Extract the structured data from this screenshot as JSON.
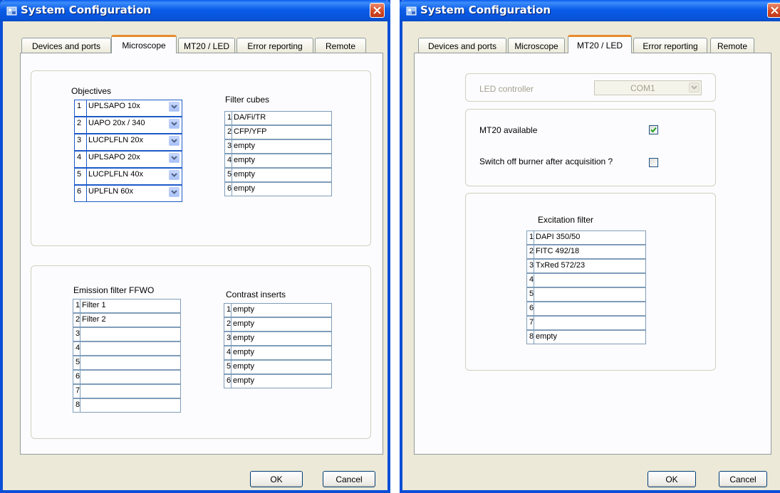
{
  "window_title": "System Configuration",
  "tabs": [
    "Devices and ports",
    "Microscope",
    "MT20 / LED",
    "Error reporting",
    "Remote"
  ],
  "buttons": {
    "ok": "OK",
    "cancel": "Cancel"
  },
  "microscope": {
    "objectives_label": "Objectives",
    "objectives": [
      {
        "num": "1",
        "value": "UPLSAPO 10x"
      },
      {
        "num": "2",
        "value": "UAPO 20x / 340"
      },
      {
        "num": "3",
        "value": "LUCPLFLN 20x"
      },
      {
        "num": "4",
        "value": "UPLSAPO 20x"
      },
      {
        "num": "5",
        "value": "LUCPLFLN 40x"
      },
      {
        "num": "6",
        "value": "UPLFLN 60x"
      }
    ],
    "filter_cubes_label": "Filter cubes",
    "filter_cubes": [
      {
        "num": "1",
        "value": "DA/Fi/TR"
      },
      {
        "num": "2",
        "value": "CFP/YFP"
      },
      {
        "num": "3",
        "value": "empty"
      },
      {
        "num": "4",
        "value": "empty"
      },
      {
        "num": "5",
        "value": "empty"
      },
      {
        "num": "6",
        "value": "empty"
      }
    ],
    "emission_label": "Emission filter FFWO",
    "emission_filters": [
      {
        "num": "1",
        "value": "Filter 1"
      },
      {
        "num": "2",
        "value": "Filter 2"
      },
      {
        "num": "3",
        "value": ""
      },
      {
        "num": "4",
        "value": ""
      },
      {
        "num": "5",
        "value": ""
      },
      {
        "num": "6",
        "value": ""
      },
      {
        "num": "7",
        "value": ""
      },
      {
        "num": "8",
        "value": ""
      }
    ],
    "contrast_label": "Contrast inserts",
    "contrast_inserts": [
      {
        "num": "1",
        "value": "empty"
      },
      {
        "num": "2",
        "value": "empty"
      },
      {
        "num": "3",
        "value": "empty"
      },
      {
        "num": "4",
        "value": "empty"
      },
      {
        "num": "5",
        "value": "empty"
      },
      {
        "num": "6",
        "value": "empty"
      }
    ]
  },
  "mt20": {
    "led_controller_label": "LED controller",
    "led_controller_value": "COM1",
    "mt20_available_label": "MT20 available",
    "mt20_available_checked": true,
    "switch_off_label": "Switch off burner after acquisition ?",
    "switch_off_checked": false,
    "excitation_label": "Excitation filter",
    "excitation_filters": [
      {
        "num": "1",
        "value": "DAPI 350/50"
      },
      {
        "num": "2",
        "value": "FITC 492/18"
      },
      {
        "num": "3",
        "value": "TxRed 572/23"
      },
      {
        "num": "4",
        "value": ""
      },
      {
        "num": "5",
        "value": ""
      },
      {
        "num": "6",
        "value": ""
      },
      {
        "num": "7",
        "value": ""
      },
      {
        "num": "8",
        "value": "empty"
      }
    ]
  },
  "colors": {
    "titlebar": "#0a5ce8",
    "active_tab_accent": "#e68b2c",
    "check": "#21a121"
  }
}
